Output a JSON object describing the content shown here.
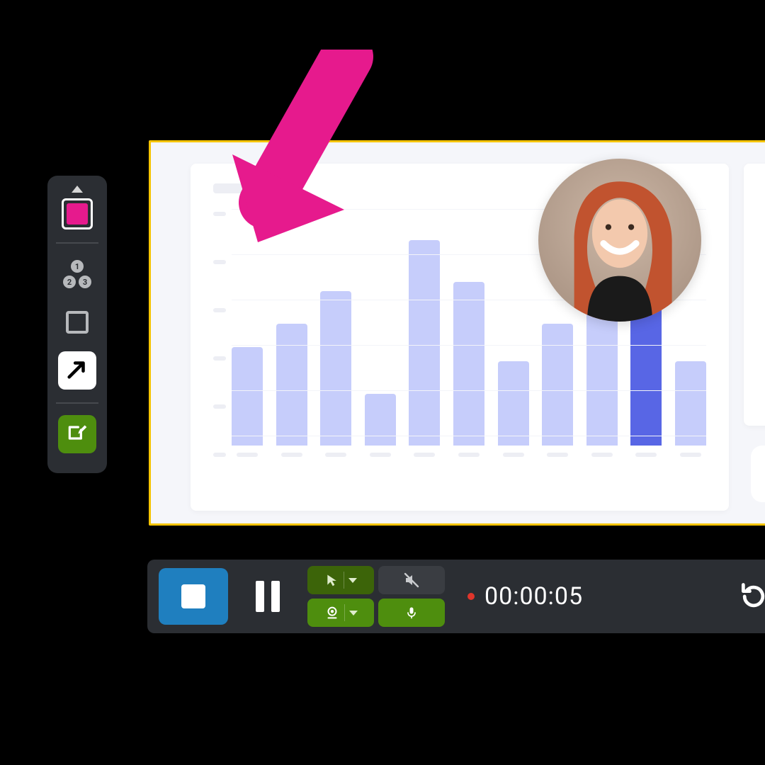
{
  "colors": {
    "accent_pink": "#e61a8d",
    "accent_green": "#4e8e0e",
    "accent_green_dark": "#3c6409",
    "accent_blue": "#1f7fbf",
    "bar_light": "#c6cdfb",
    "bar_highlight": "#5866e5",
    "canvas_border": "#f5c400",
    "rec_dot": "#e0352b"
  },
  "side_toolbar": {
    "current_color_icon": "color-swatch",
    "tools": [
      {
        "id": "numbered-steps",
        "icon": "numbered-circles-icon",
        "n1": "1",
        "n2": "2",
        "n3": "3"
      },
      {
        "id": "rectangle",
        "icon": "rectangle-icon"
      },
      {
        "id": "arrow",
        "icon": "arrow-icon",
        "active": true
      },
      {
        "id": "draw",
        "icon": "pencil-square-icon",
        "style": "green"
      }
    ]
  },
  "recording_bar": {
    "stop_icon": "stop-icon",
    "pause_icon": "pause-icon",
    "cursor_effects_icon": "cursor-icon",
    "webcam_toggle_icon": "webcam-icon",
    "mic_toggle_icon": "mic-icon",
    "speaker_toggle_icon": "speaker-muted-icon",
    "undo_icon": "undo-icon",
    "timer": "00:00:05"
  },
  "webcam_overlay": {
    "shape": "circle",
    "subject": "person-smiling"
  },
  "annotation": {
    "type": "arrow",
    "color": "#e61a8d"
  },
  "chart_data": {
    "type": "bar",
    "title": "",
    "xlabel": "",
    "ylabel": "",
    "ylim": [
      0,
      100
    ],
    "highlight_index": 9,
    "categories": [
      "",
      "",
      "",
      "",
      "",
      "",
      "",
      "",
      "",
      "",
      ""
    ],
    "values": [
      42,
      52,
      66,
      22,
      88,
      70,
      36,
      52,
      60,
      90,
      36
    ]
  }
}
